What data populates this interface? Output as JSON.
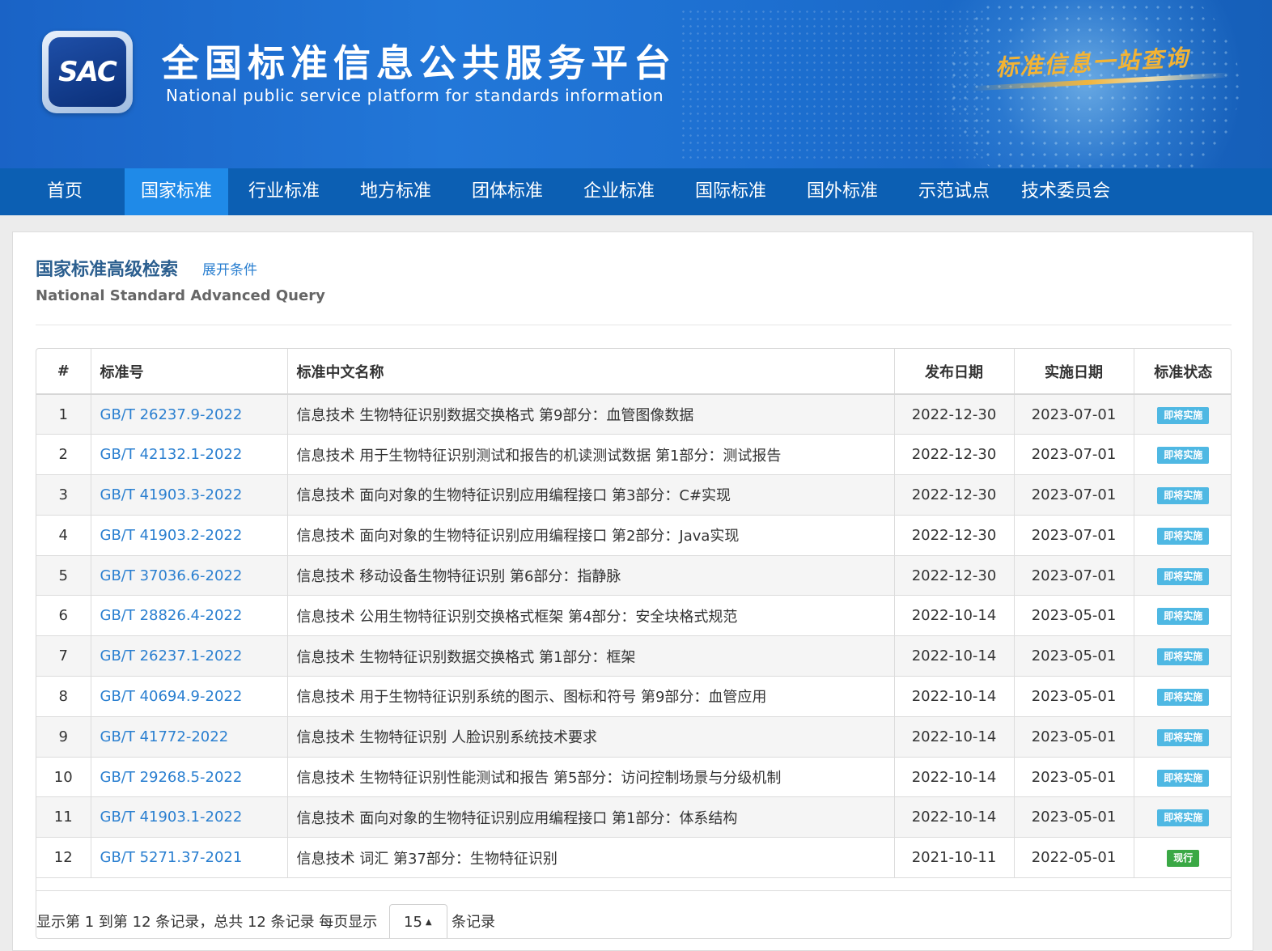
{
  "header": {
    "logo_text": "SAC",
    "title_cn": "全国标准信息公共服务平台",
    "title_en": "National public service platform  for standards information",
    "slogan": "标准信息一站查询"
  },
  "nav": {
    "items": [
      {
        "label": "首页"
      },
      {
        "label": "国家标准"
      },
      {
        "label": "行业标准"
      },
      {
        "label": "地方标准"
      },
      {
        "label": "团体标准"
      },
      {
        "label": "企业标准"
      },
      {
        "label": "国际标准"
      },
      {
        "label": "国外标准"
      },
      {
        "label": "示范试点"
      },
      {
        "label": "技术委员会"
      }
    ],
    "active": "国家标准"
  },
  "search": {
    "title": "国家标准高级检索",
    "expand_label": "展开条件",
    "subtitle": "National Standard Advanced Query"
  },
  "table": {
    "headers": [
      "#",
      "标准号",
      "标准中文名称",
      "发布日期",
      "实施日期",
      "标准状态"
    ],
    "rows": [
      {
        "no": "1",
        "code": "GB/T 26237.9-2022",
        "name": "信息技术 生物特征识别数据交换格式 第9部分：血管图像数据",
        "pub": "2022-12-30",
        "impl": "2023-07-01",
        "status": "即将实施"
      },
      {
        "no": "2",
        "code": "GB/T 42132.1-2022",
        "name": "信息技术 用于生物特征识别测试和报告的机读测试数据 第1部分：测试报告",
        "pub": "2022-12-30",
        "impl": "2023-07-01",
        "status": "即将实施"
      },
      {
        "no": "3",
        "code": "GB/T 41903.3-2022",
        "name": "信息技术 面向对象的生物特征识别应用编程接口 第3部分：C#实现",
        "pub": "2022-12-30",
        "impl": "2023-07-01",
        "status": "即将实施"
      },
      {
        "no": "4",
        "code": "GB/T 41903.2-2022",
        "name": "信息技术 面向对象的生物特征识别应用编程接口 第2部分：Java实现",
        "pub": "2022-12-30",
        "impl": "2023-07-01",
        "status": "即将实施"
      },
      {
        "no": "5",
        "code": "GB/T 37036.6-2022",
        "name": "信息技术 移动设备生物特征识别 第6部分：指静脉",
        "pub": "2022-12-30",
        "impl": "2023-07-01",
        "status": "即将实施"
      },
      {
        "no": "6",
        "code": "GB/T 28826.4-2022",
        "name": "信息技术 公用生物特征识别交换格式框架 第4部分：安全块格式规范",
        "pub": "2022-10-14",
        "impl": "2023-05-01",
        "status": "即将实施"
      },
      {
        "no": "7",
        "code": "GB/T 26237.1-2022",
        "name": "信息技术 生物特征识别数据交换格式 第1部分：框架",
        "pub": "2022-10-14",
        "impl": "2023-05-01",
        "status": "即将实施"
      },
      {
        "no": "8",
        "code": "GB/T 40694.9-2022",
        "name": "信息技术 用于生物特征识别系统的图示、图标和符号 第9部分：血管应用",
        "pub": "2022-10-14",
        "impl": "2023-05-01",
        "status": "即将实施"
      },
      {
        "no": "9",
        "code": "GB/T 41772-2022",
        "name": "信息技术 生物特征识别 人脸识别系统技术要求",
        "pub": "2022-10-14",
        "impl": "2023-05-01",
        "status": "即将实施"
      },
      {
        "no": "10",
        "code": "GB/T 29268.5-2022",
        "name": "信息技术 生物特征识别性能测试和报告 第5部分：访问控制场景与分级机制",
        "pub": "2022-10-14",
        "impl": "2023-05-01",
        "status": "即将实施"
      },
      {
        "no": "11",
        "code": "GB/T 41903.1-2022",
        "name": "信息技术 面向对象的生物特征识别应用编程接口 第1部分：体系结构",
        "pub": "2022-10-14",
        "impl": "2023-05-01",
        "status": "即将实施"
      },
      {
        "no": "12",
        "code": "GB/T 5271.37-2021",
        "name": "信息技术 词汇 第37部分：生物特征识别",
        "pub": "2021-10-11",
        "impl": "2022-05-01",
        "status": "现行"
      }
    ]
  },
  "pagination": {
    "summary": "显示第 1 到第 12 条记录，总共 12 条记录 每页显示",
    "page_size": "15",
    "suffix": "条记录"
  },
  "colors": {
    "nav_bg": "#0c5fb3",
    "nav_active": "#1f8ae8",
    "link": "#2a7fd0",
    "status_soon": "#4fb8e3",
    "status_current": "#3aa845"
  }
}
